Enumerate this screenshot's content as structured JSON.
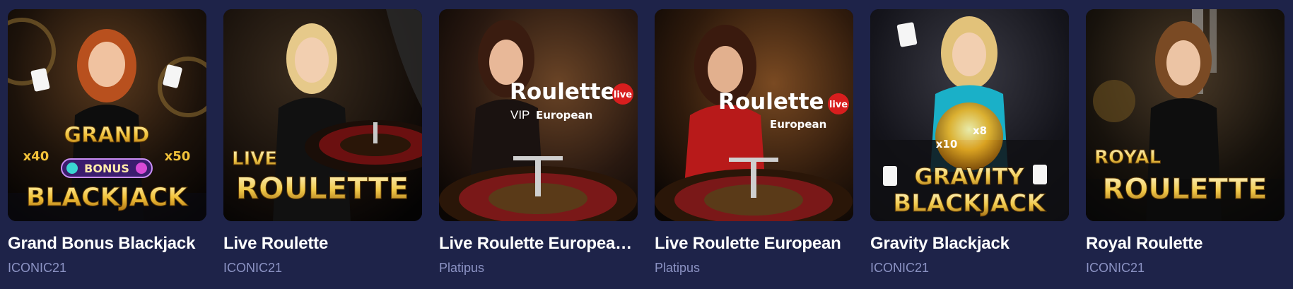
{
  "games": [
    {
      "title": "Grand Bonus Blackjack",
      "provider": "ICONIC21",
      "art": {
        "line1": "GRAND",
        "line2": "BONUS",
        "line3": "BLACKJACK",
        "mult_left": "x40",
        "mult_right": "x50"
      }
    },
    {
      "title": "Live Roulette",
      "provider": "ICONIC21",
      "art": {
        "line1": "LIVE",
        "line2": "ROULETTE"
      }
    },
    {
      "title": "Live Roulette Europea…",
      "provider": "Platipus",
      "art": {
        "brand": "Roulette",
        "badge": "live",
        "sub1": "VIP",
        "sub2": "European"
      }
    },
    {
      "title": "Live Roulette European",
      "provider": "Platipus",
      "art": {
        "brand": "Roulette",
        "badge": "live",
        "sub2": "European"
      }
    },
    {
      "title": "Gravity Blackjack",
      "provider": "ICONIC21",
      "art": {
        "line1": "GRAVITY",
        "line2": "BLACKJACK",
        "mult_a": "x10",
        "mult_b": "x8"
      }
    },
    {
      "title": "Royal Roulette",
      "provider": "ICONIC21",
      "art": {
        "line1": "ROYAL",
        "line2": "ROULETTE"
      }
    }
  ]
}
